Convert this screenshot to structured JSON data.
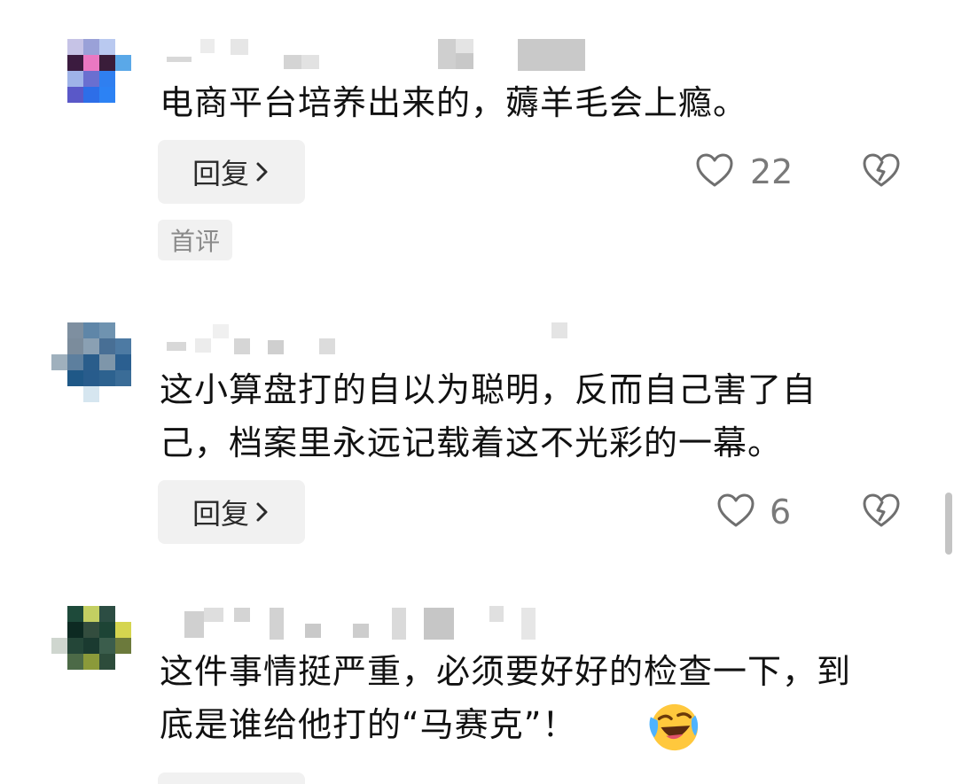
{
  "comments": [
    {
      "text": "电商平台培养出来的，薅羊毛会上瘾。",
      "reply_label": "回复",
      "likes": "22",
      "badge": "首评"
    },
    {
      "text_line1": "这小算盘打的自以为聪明，反而自己害了自",
      "text_line2": "己，档案里永远记载着这不光彩的一幕。",
      "reply_label": "回复",
      "likes": "6"
    },
    {
      "text_line1": "这件事情挺严重，必须要好好的检查一下，到",
      "text_line2": "底是谁给他打的“马赛克”！",
      "emoji": "laughing-crying-emoji"
    }
  ],
  "icons": {
    "like": "heart-outline-icon",
    "dislike": "broken-heart-icon",
    "reply_chevron": "chevron-right-icon"
  },
  "colors": {
    "text": "#111111",
    "muted": "#7a7a7a",
    "button_bg": "#f1f1f1",
    "emoji_yellow": "#ffc83d"
  }
}
